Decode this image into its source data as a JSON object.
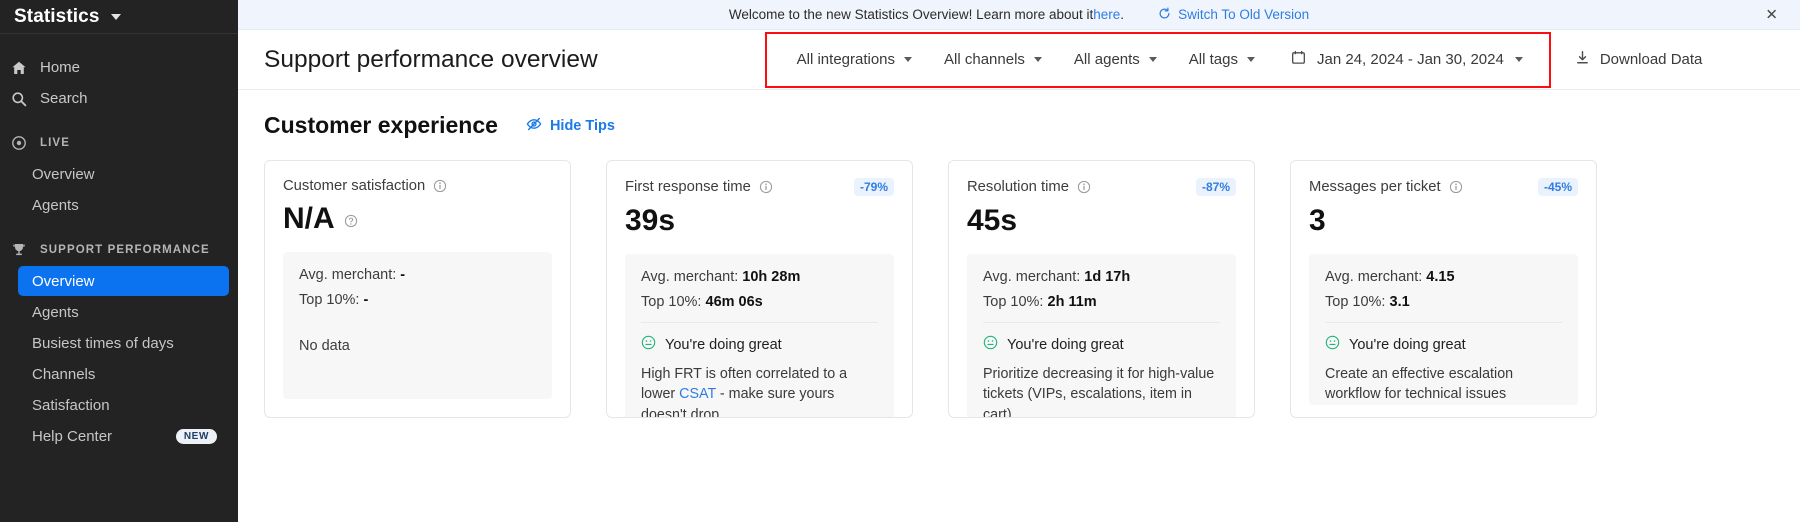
{
  "sidebar": {
    "brand": "Statistics",
    "nav": [
      {
        "label": "Home",
        "icon": "home-icon"
      },
      {
        "label": "Search",
        "icon": "search-icon"
      }
    ],
    "live": {
      "label": "LIVE",
      "icon": "live-dot-icon",
      "items": [
        "Overview",
        "Agents"
      ]
    },
    "support": {
      "label": "SUPPORT PERFORMANCE",
      "icon": "trophy-icon",
      "items": [
        {
          "label": "Overview",
          "active": true,
          "badge": ""
        },
        {
          "label": "Agents",
          "active": false,
          "badge": ""
        },
        {
          "label": "Busiest times of days",
          "active": false,
          "badge": ""
        },
        {
          "label": "Channels",
          "active": false,
          "badge": ""
        },
        {
          "label": "Satisfaction",
          "active": false,
          "badge": ""
        },
        {
          "label": "Help Center",
          "active": false,
          "badge": "NEW"
        }
      ]
    },
    "accent": "#0b72f0"
  },
  "banner": {
    "text": "Welcome to the new Statistics Overview! Learn more about it ",
    "link": "here",
    "period": ".",
    "switch": "Switch To Old Version",
    "switch_icon": "refresh-icon",
    "close_icon": "close-icon",
    "background": "#f0f5fd",
    "link_color": "#2f7de1"
  },
  "header": {
    "title": "Support performance overview",
    "filters": [
      {
        "label": "All integrations",
        "icon": "chevron-down-icon"
      },
      {
        "label": "All channels",
        "icon": "chevron-down-icon"
      },
      {
        "label": "All agents",
        "icon": "chevron-down-icon"
      },
      {
        "label": "All tags",
        "icon": "chevron-down-icon"
      }
    ],
    "date_range": "Jan 24, 2024 - Jan 30, 2024",
    "date_icon": "calendar-icon",
    "download": "Download Data",
    "download_icon": "download-icon",
    "highlight_color": "#fd0d0d"
  },
  "section": {
    "title": "Customer experience",
    "hide_tips": "Hide Tips",
    "hide_tips_icon": "eye-off-icon"
  },
  "cards": [
    {
      "title": "Customer satisfaction",
      "value": "N/A",
      "value_help_icon": "question-circle-icon",
      "delta": "",
      "avg_label": "Avg. merchant:",
      "avg_value": "-",
      "top_label": "Top 10%:",
      "top_value": "-",
      "tip_status": "",
      "tip_text": "",
      "tip_link": "",
      "tip_text_after": "",
      "no_data": "No data"
    },
    {
      "title": "First response time",
      "value": "39s",
      "value_help_icon": "",
      "delta": "-79%",
      "avg_label": "Avg. merchant:",
      "avg_value": "10h 28m",
      "top_label": "Top 10%:",
      "top_value": "46m 06s",
      "tip_status": "You're doing great",
      "tip_text": "High FRT is often correlated to a lower ",
      "tip_link": "CSAT",
      "tip_text_after": " - make sure yours doesn't drop.",
      "no_data": ""
    },
    {
      "title": "Resolution time",
      "value": "45s",
      "value_help_icon": "",
      "delta": "-87%",
      "avg_label": "Avg. merchant:",
      "avg_value": "1d 17h",
      "top_label": "Top 10%:",
      "top_value": "2h 11m",
      "tip_status": "You're doing great",
      "tip_text": "Prioritize decreasing it for high-value tickets (VIPs, escalations, item in cart)",
      "tip_link": "",
      "tip_text_after": "",
      "no_data": ""
    },
    {
      "title": "Messages per ticket",
      "value": "3",
      "value_help_icon": "",
      "delta": "-45%",
      "avg_label": "Avg. merchant:",
      "avg_value": "4.15",
      "top_label": "Top 10%:",
      "top_value": "3.1",
      "tip_status": "You're doing great",
      "tip_text": "Create an effective escalation workflow for technical issues",
      "tip_link": "",
      "tip_text_after": "",
      "no_data": ""
    }
  ]
}
